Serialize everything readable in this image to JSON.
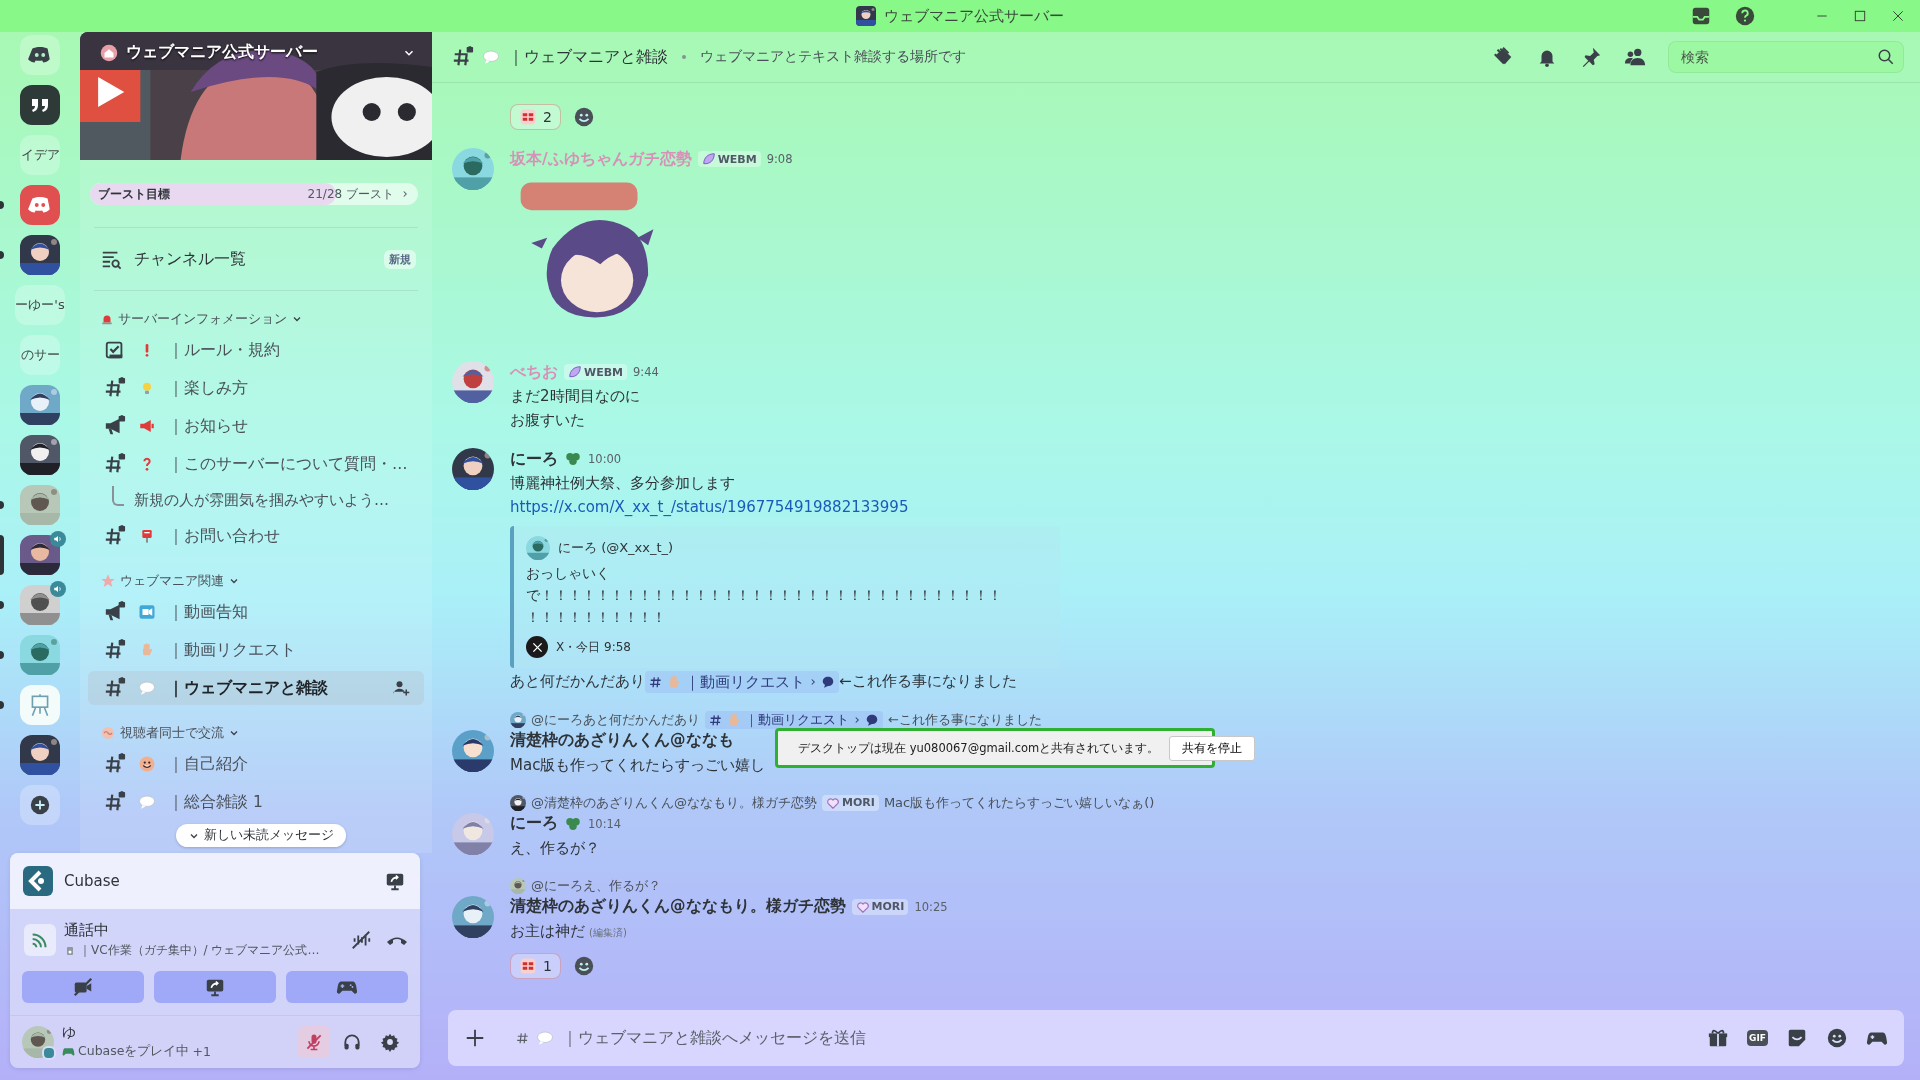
{
  "titlebar": {
    "title": "ウェブマニア公式サーバー"
  },
  "servers": [
    {
      "kind": "logo",
      "unread": false,
      "selected": false,
      "voice": false
    },
    {
      "kind": "quote",
      "unread": false,
      "selected": false,
      "voice": false
    },
    {
      "kind": "text",
      "label": "イデア",
      "unread": false,
      "selected": false,
      "voice": false
    },
    {
      "kind": "discord",
      "unread": true,
      "selected": false,
      "voice": false
    },
    {
      "kind": "picture",
      "unread": true,
      "selected": false,
      "voice": false
    },
    {
      "kind": "text",
      "label": "ーゆー's",
      "unread": false,
      "selected": false,
      "voice": false
    },
    {
      "kind": "text",
      "label": "のサー",
      "unread": false,
      "selected": false,
      "voice": false
    },
    {
      "kind": "picture",
      "unread": false,
      "selected": false,
      "voice": false
    },
    {
      "kind": "picture",
      "unread": false,
      "selected": false,
      "voice": false
    },
    {
      "kind": "picture",
      "unread": true,
      "selected": false,
      "voice": false
    },
    {
      "kind": "picture",
      "unread": false,
      "selected": true,
      "voice": true
    },
    {
      "kind": "picture",
      "unread": true,
      "selected": false,
      "voice": true
    },
    {
      "kind": "picture",
      "unread": true,
      "selected": false,
      "voice": false
    },
    {
      "kind": "easel",
      "unread": true,
      "selected": false,
      "voice": false
    },
    {
      "kind": "picture",
      "unread": false,
      "selected": false,
      "voice": false
    },
    {
      "kind": "add",
      "unread": false,
      "selected": false,
      "voice": false
    }
  ],
  "server": {
    "name": "ウェブマニア公式サーバー",
    "boost": {
      "label": "ブースト目標",
      "progress": "21/28 ブースト",
      "level": 0.75
    }
  },
  "browse": {
    "label": "チャンネル一覧",
    "badge": "新規"
  },
  "categories": [
    {
      "name": "サーバーインフォメーション",
      "icon": {
        "kind": "siren"
      },
      "expanded": true,
      "channels": [
        {
          "kind": "rules",
          "icon": {
            "kind": "exclamation"
          },
          "name": "｜ルール・規約",
          "selected": false
        },
        {
          "kind": "text",
          "icon": {
            "kind": "bulb"
          },
          "name": "｜楽しみ方",
          "selected": false
        },
        {
          "kind": "announcement",
          "icon": {
            "kind": "loudspeaker"
          },
          "name": "｜お知らせ",
          "selected": false
        },
        {
          "kind": "text",
          "icon": {
            "kind": "question"
          },
          "name": "｜このサーバーについて質問・…",
          "selected": false,
          "threads": [
            {
              "name": "新規の人が雰囲気を掴みやすいよう…"
            }
          ]
        },
        {
          "kind": "text",
          "icon": {
            "kind": "mailbox"
          },
          "name": "｜お問い合わせ",
          "selected": false
        }
      ]
    },
    {
      "name": "ウェブマニア関連",
      "icon": {
        "kind": "star"
      },
      "expanded": true,
      "channels": [
        {
          "kind": "announcement",
          "icon": {
            "kind": "video"
          },
          "name": "｜動画告知",
          "selected": false
        },
        {
          "kind": "text",
          "icon": {
            "kind": "hand"
          },
          "name": "｜動画リクエスト",
          "selected": false
        },
        {
          "kind": "text",
          "icon": {
            "kind": "speech"
          },
          "name": "｜ウェブマニアと雑談",
          "selected": true
        }
      ]
    },
    {
      "name": "視聴者同士で交流",
      "icon": {
        "kind": "wave"
      },
      "expanded": true,
      "channels": [
        {
          "kind": "text",
          "icon": {
            "kind": "smile"
          },
          "name": "｜自己紹介",
          "selected": false
        },
        {
          "kind": "text",
          "icon": {
            "kind": "speech"
          },
          "name": "｜総合雑談 1",
          "selected": false
        }
      ]
    }
  ],
  "unread_pill": "新しい未読メッセージ",
  "activity": {
    "name": "Cubase"
  },
  "voice": {
    "status": "通話中",
    "channel": "｜VC作業（ガチ集中）/ ウェブマニア公式…"
  },
  "user": {
    "name": "ゆ",
    "status": "Cubaseをプレイ中",
    "extra": "+1",
    "muted": true
  },
  "channel_header": {
    "name": "｜ウェブマニアと雑談",
    "topic": "ウェブマニアとテキスト雑談する場所です"
  },
  "search": {
    "placeholder": "検索"
  },
  "messages": [
    {
      "kind": "reactions",
      "reactions": [
        {
          "count": "2"
        }
      ]
    },
    {
      "kind": "message",
      "author": "坂本/ふゆちゃんガチ恋勢",
      "color": "#d890b8",
      "badge": false,
      "tag": {
        "kind": "leaf",
        "text": "WEBM"
      },
      "time": "9:08",
      "content": [
        {
          "kind": "sticker"
        }
      ]
    },
    {
      "kind": "message",
      "author": "べちお",
      "color": "#d890b8",
      "badge": false,
      "tag": {
        "kind": "leaf",
        "text": "WEBM"
      },
      "time": "9:44",
      "content": [
        {
          "kind": "text",
          "text": "まだ2時間目なのに"
        },
        {
          "kind": "text",
          "text": "お腹すいた"
        }
      ]
    },
    {
      "kind": "message",
      "author": "にーろ",
      "color": "#2e3338",
      "badge": true,
      "time": "10:00",
      "content": [
        {
          "kind": "text",
          "text": "博麗神社例大祭、多分参加します"
        },
        {
          "kind": "link",
          "text": "https://x.com/X_xx_t_/status/1967754919882133995"
        },
        {
          "kind": "embed",
          "author": "にーろ (@X_xx_t_)",
          "lines": [
            "おっしゃいく",
            "で！！！！！！！！！！！！！！！！！！！！！！！！！！！！！！！！！",
            "！！！！！！！！！！"
          ],
          "footer": "X・今日 9:58"
        },
        {
          "kind": "rich",
          "parts": [
            {
              "kind": "text",
              "text": "あと何だかんだあり"
            },
            {
              "kind": "mention",
              "icon": {
                "kind": "hand"
              },
              "name": "｜動画リクエスト"
            },
            {
              "kind": "text",
              "text": "←これ作る事になりました"
            }
          ]
        }
      ]
    },
    {
      "kind": "message",
      "reply": {
        "author": "@にーろ",
        "parts": [
          {
            "kind": "text",
            "text": "あと何だかんだあり"
          },
          {
            "kind": "mention",
            "icon": {
              "kind": "hand"
            },
            "name": "｜動画リクエスト"
          },
          {
            "kind": "text",
            "text": "←これ作る事になりました"
          }
        ]
      },
      "author": "清楚枠のあざりんくん@ななも",
      "color": "#2e3338",
      "badge": false,
      "content": [
        {
          "kind": "text",
          "text": "Mac版も作ってくれたらすっごい嬉し"
        }
      ]
    },
    {
      "kind": "message",
      "reply": {
        "author": "@清楚枠のあざりんくん@ななもり。様ガチ恋勢",
        "tag": {
          "kind": "heart",
          "text": "MORI"
        },
        "parts": [
          {
            "kind": "text",
            "text": "Mac版も作ってくれたらすっごい嬉しいなぁ()"
          }
        ]
      },
      "author": "にーろ",
      "color": "#2e3338",
      "badge": true,
      "time": "10:14",
      "content": [
        {
          "kind": "text",
          "text": "え、作るが？"
        }
      ]
    },
    {
      "kind": "message",
      "reply": {
        "author": "@にーろ",
        "parts": [
          {
            "kind": "text",
            "text": "え、作るが？"
          }
        ]
      },
      "author": "清楚枠のあざりんくん@ななもり。様ガチ恋勢",
      "color": "#2e3338",
      "badge": false,
      "tag": {
        "kind": "heart",
        "text": "MORI"
      },
      "time": "10:25",
      "content": [
        {
          "kind": "text",
          "text": "お主は神だ",
          "edited": "(編集済)"
        },
        {
          "kind": "reactions",
          "reactions": [
            {
              "count": "1"
            }
          ]
        }
      ]
    }
  ],
  "share_notice": {
    "text": "デスクトップは現在 yu080067@gmail.comと共有されています。",
    "button": "共有を停止"
  },
  "composer": {
    "placeholder": "｜ウェブマニアと雑談へメッセージを送信",
    "gif": "GIF"
  }
}
